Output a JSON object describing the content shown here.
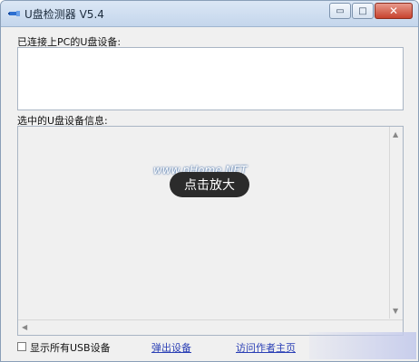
{
  "window": {
    "title": "U盘检测器 V5.4",
    "buttons": {
      "minimize": "▭",
      "maximize": "□",
      "close": "✕"
    }
  },
  "section1": {
    "label": "已连接上PC的U盘设备:"
  },
  "section2": {
    "label": "选中的U盘设备信息:"
  },
  "overlay": {
    "watermark": "www.pHome.NET",
    "zoom_label": "点击放大"
  },
  "footer": {
    "checkbox_label": "显示所有USB设备",
    "eject_link": "弹出设备",
    "visit_link": "访问作者主页"
  },
  "colors": {
    "title_bg": "#c4d6ec",
    "close_red": "#c7432e",
    "link_blue": "#2a3fb5"
  }
}
